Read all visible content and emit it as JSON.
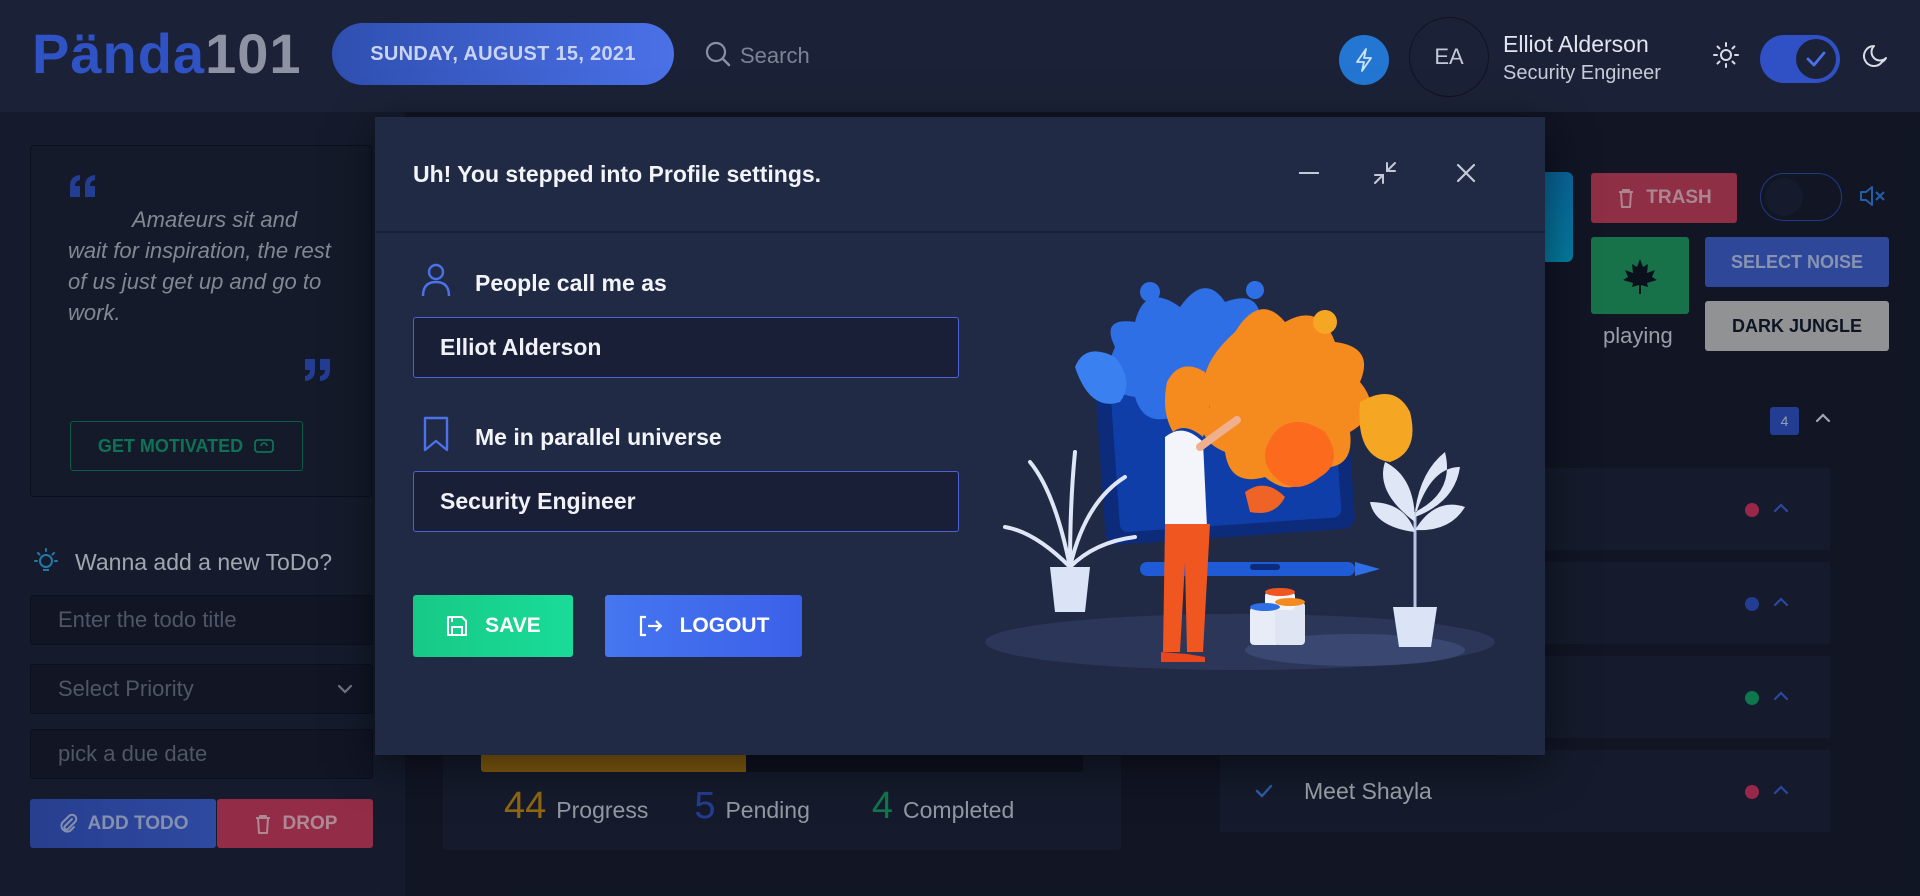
{
  "brand": {
    "part1": "Pända",
    "part2": "101"
  },
  "header": {
    "date": "SUNDAY, AUGUST 15, 2021",
    "search_placeholder": "Search",
    "avatar_initials": "EA",
    "user_name": "Elliot Alderson",
    "user_role": "Security Engineer"
  },
  "sidebar": {
    "quote": "Amateurs sit and wait for inspiration, the rest of us just get up and go to work.",
    "motivate_label": "GET MOTIVATED",
    "todo_heading": "Wanna add a new ToDo?",
    "todo_title_placeholder": "Enter the todo title",
    "priority_placeholder": "Select Priority",
    "due_placeholder": "pick a due date",
    "add_label": "ADD TODO",
    "drop_label": "DROP"
  },
  "progress": {
    "fill_percent": 44,
    "progress_value": "44",
    "progress_label": "Progress",
    "pending_value": "5",
    "pending_label": "Pending",
    "completed_value": "4",
    "completed_label": "Completed"
  },
  "noise": {
    "trash_label": "TRASH",
    "playing_label": "playing",
    "select_noise_label": "SELECT NOISE",
    "dark_jungle_label": "DARK JUNGLE"
  },
  "todos": {
    "count": "4",
    "visible_item": "Meet Shayla",
    "priority_colors": [
      "#d0335f",
      "#2f51c5",
      "#13a166",
      "#d0335f"
    ]
  },
  "modal": {
    "title": "Uh! You stepped into Profile settings.",
    "name_label": "People call me as",
    "name_value": "Elliot Alderson",
    "role_label": "Me in parallel universe",
    "role_value": "Security Engineer",
    "save_label": "SAVE",
    "logout_label": "LOGOUT"
  },
  "colors": {
    "accent": "#2f51c5",
    "background": "#151a2b",
    "panel": "#1b2237",
    "modal": "#212a45",
    "success": "#18c986",
    "danger": "#c93b5c",
    "warning": "#b07a10"
  }
}
